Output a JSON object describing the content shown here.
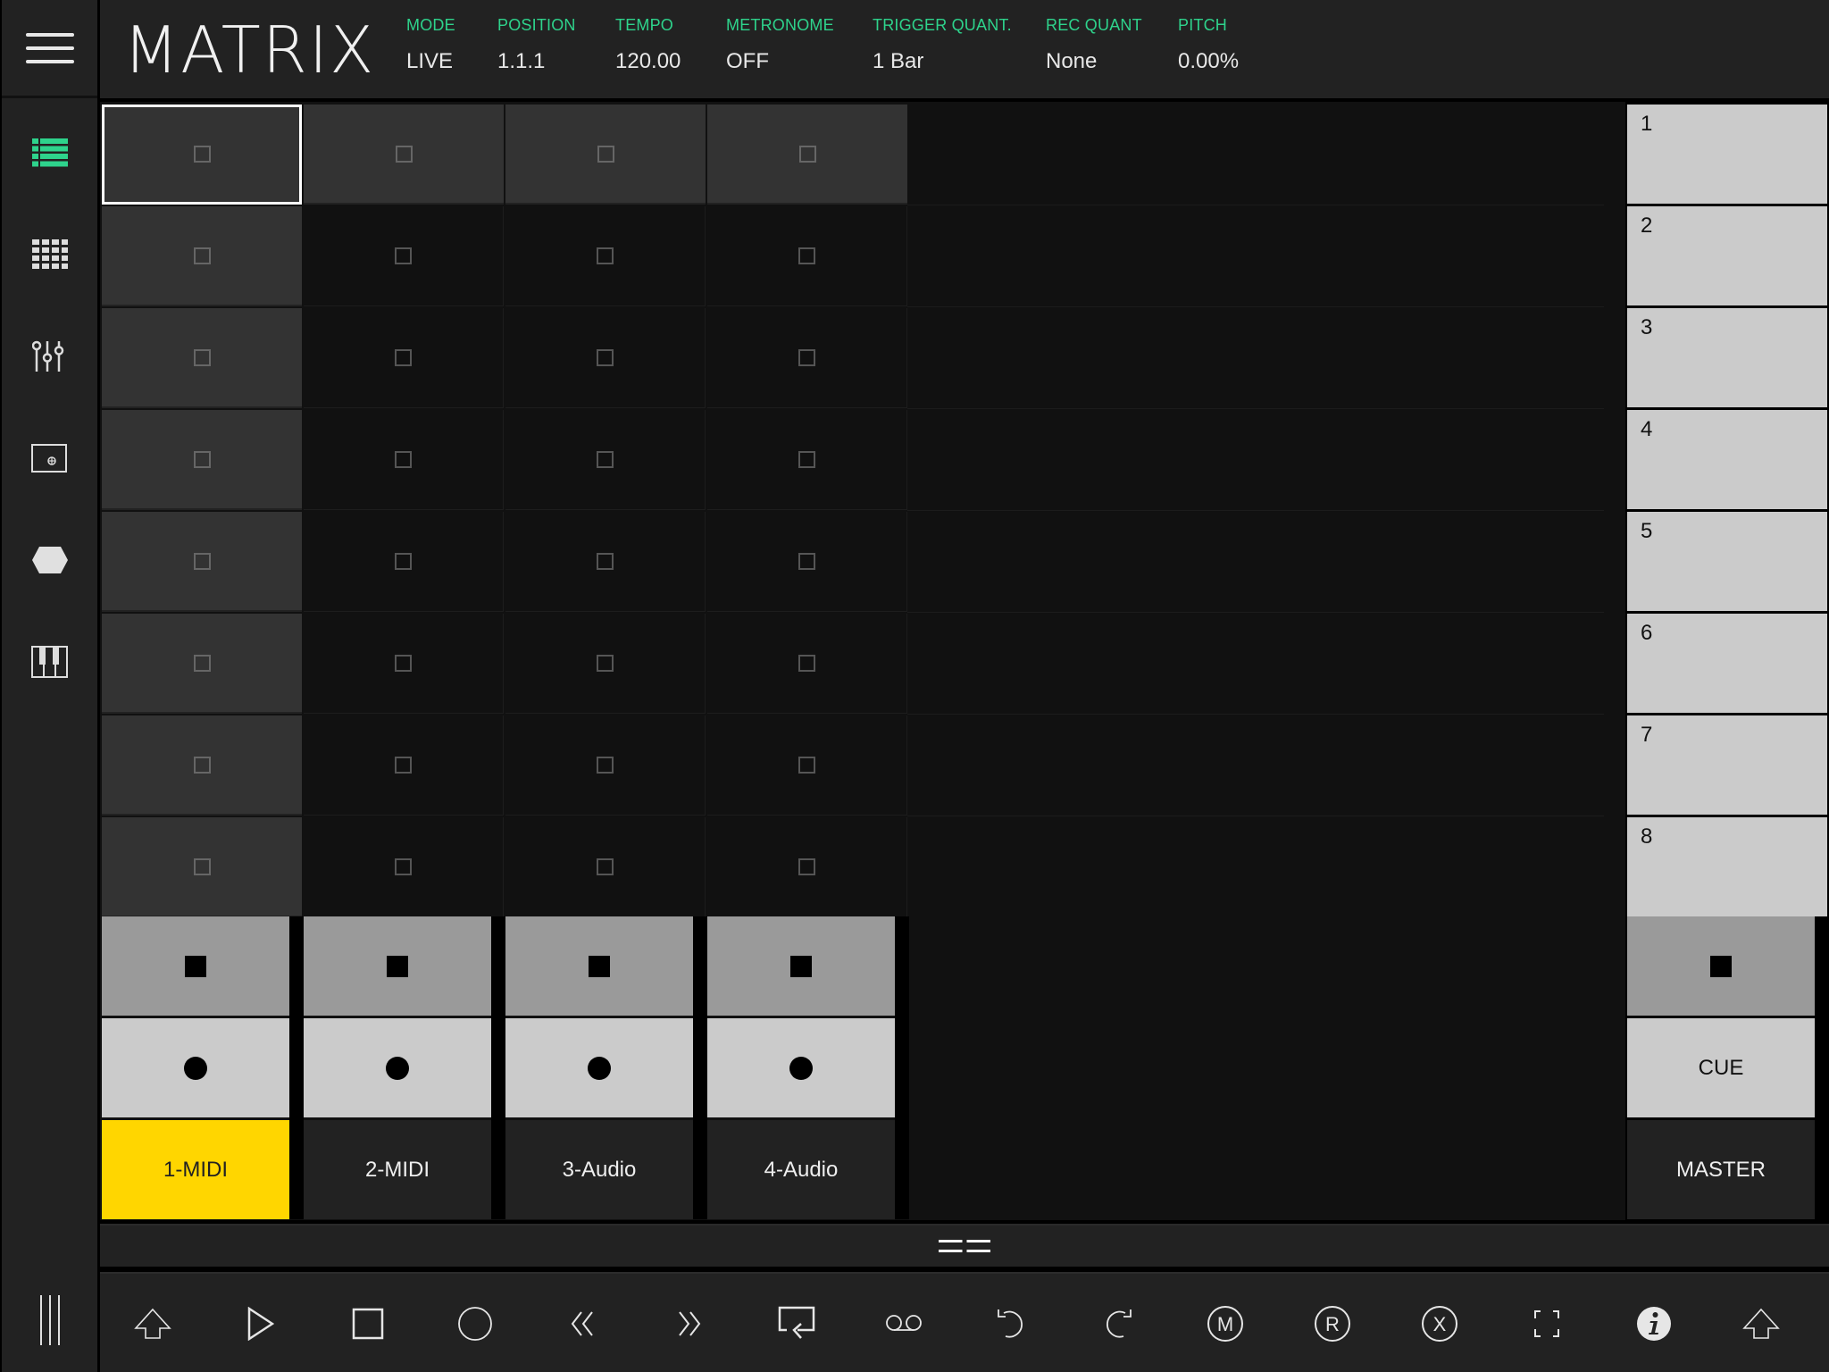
{
  "header": {
    "title": "MATRIX",
    "fields": [
      {
        "label": "MODE",
        "value": "LIVE"
      },
      {
        "label": "POSITION",
        "value": "1.1.1"
      },
      {
        "label": "TEMPO",
        "value": "120.00"
      },
      {
        "label": "METRONOME",
        "value": "OFF"
      },
      {
        "label": "TRIGGER QUANT.",
        "value": "1 Bar"
      },
      {
        "label": "REC QUANT",
        "value": "None"
      },
      {
        "label": "PITCH",
        "value": "0.00%"
      }
    ]
  },
  "sidebar": {
    "items": [
      {
        "icon": "clip-list-icon",
        "active": true
      },
      {
        "icon": "grid-matrix-icon",
        "active": false
      },
      {
        "icon": "mixer-sliders-icon",
        "active": false
      },
      {
        "icon": "xy-pad-icon",
        "active": false
      },
      {
        "icon": "hexagon-device-icon",
        "active": false
      },
      {
        "icon": "piano-keys-icon",
        "active": false
      }
    ],
    "bottom_icon": "vertical-lines-icon"
  },
  "matrix": {
    "rows": 8,
    "columns": 4,
    "selected_cell": {
      "row": 1,
      "column": 1
    }
  },
  "scenes": [
    "1",
    "2",
    "3",
    "4",
    "5",
    "6",
    "7",
    "8"
  ],
  "tracks": [
    {
      "name": "1-MIDI",
      "selected": true
    },
    {
      "name": "2-MIDI",
      "selected": false
    },
    {
      "name": "3-Audio",
      "selected": false
    },
    {
      "name": "4-Audio",
      "selected": false
    }
  ],
  "master": {
    "cue_label": "CUE",
    "name": "MASTER"
  },
  "colors": {
    "accent_green": "#2ed38c",
    "selected_track_yellow": "#ffd600"
  },
  "transport": {
    "buttons": [
      "shift-arrow-icon",
      "play-icon",
      "stop-icon",
      "record-icon",
      "rewind-icon",
      "fast-forward-icon",
      "loop-icon",
      "tape-icon",
      "undo-icon",
      "redo-icon",
      "mute-m-icon",
      "record-r-icon",
      "close-x-icon",
      "fullscreen-icon",
      "info-icon",
      "shift-arrow-right-icon"
    ]
  }
}
